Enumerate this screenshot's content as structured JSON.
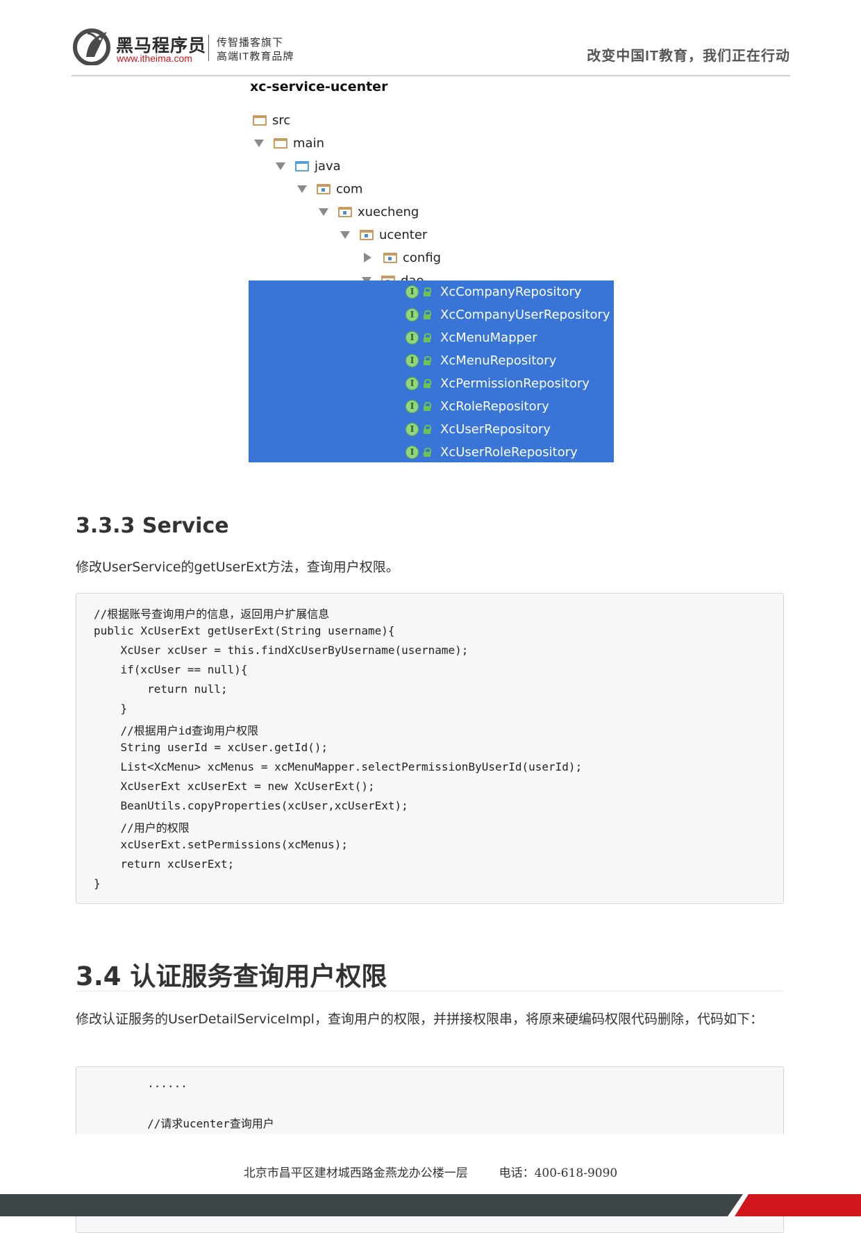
{
  "header": {
    "brand_name": "黑马程序员",
    "brand_url": "www.itheima.com",
    "slogan_line1": "传智播客旗下",
    "slogan_line2": "高端IT教育品牌",
    "tagline": "改变中国IT教育，我们正在行动",
    "accent_color": "#c8161d"
  },
  "tree": {
    "title": "xc-service-ucenter",
    "nodes": [
      {
        "label": "src"
      },
      {
        "label": "main"
      },
      {
        "label": "java"
      },
      {
        "label": "com"
      },
      {
        "label": "xuecheng"
      },
      {
        "label": "ucenter"
      },
      {
        "label": "config"
      },
      {
        "label": "dao"
      }
    ],
    "interface_icon_letter": "I",
    "selected_items": [
      {
        "label": "XcCompanyRepository"
      },
      {
        "label": "XcCompanyUserRepository"
      },
      {
        "label": "XcMenuMapper"
      },
      {
        "label": "XcMenuRepository"
      },
      {
        "label": "XcPermissionRepository"
      },
      {
        "label": "XcRoleRepository"
      },
      {
        "label": "XcUserRepository"
      },
      {
        "label": "XcUserRoleRepository"
      }
    ],
    "selection_color": "#3875d7"
  },
  "section_333": {
    "heading": "3.3.3 Service",
    "paragraph": "修改UserService的getUserExt方法，查询用户权限。",
    "code": [
      "//根据账号查询用户的信息，返回用户扩展信息",
      "public XcUserExt getUserExt(String username){",
      "    XcUser xcUser = this.findXcUserByUsername(username);",
      "    if(xcUser == null){",
      "        return null;",
      "    }",
      "    //根据用户id查询用户权限",
      "    String userId = xcUser.getId();",
      "    List<XcMenu> xcMenus = xcMenuMapper.selectPermissionByUserId(userId);",
      "    XcUserExt xcUserExt = new XcUserExt();",
      "    BeanUtils.copyProperties(xcUser,xcUserExt);",
      "    //用户的权限",
      "    xcUserExt.setPermissions(xcMenus);",
      "    return xcUserExt;",
      "}"
    ]
  },
  "section_34": {
    "heading": "3.4 认证服务查询用户权限",
    "paragraph": "修改认证服务的UserDetailServiceImpl，查询用户的权限，并拼接权限串，将原来硬编码权限代码删除，代码如下：",
    "code": [
      "        ......",
      "",
      "        //请求ucenter查询用户"
    ]
  },
  "footer": {
    "address": "北京市昌平区建材城西路金燕龙办公楼一层",
    "phone": "电话：400-618-9090"
  }
}
